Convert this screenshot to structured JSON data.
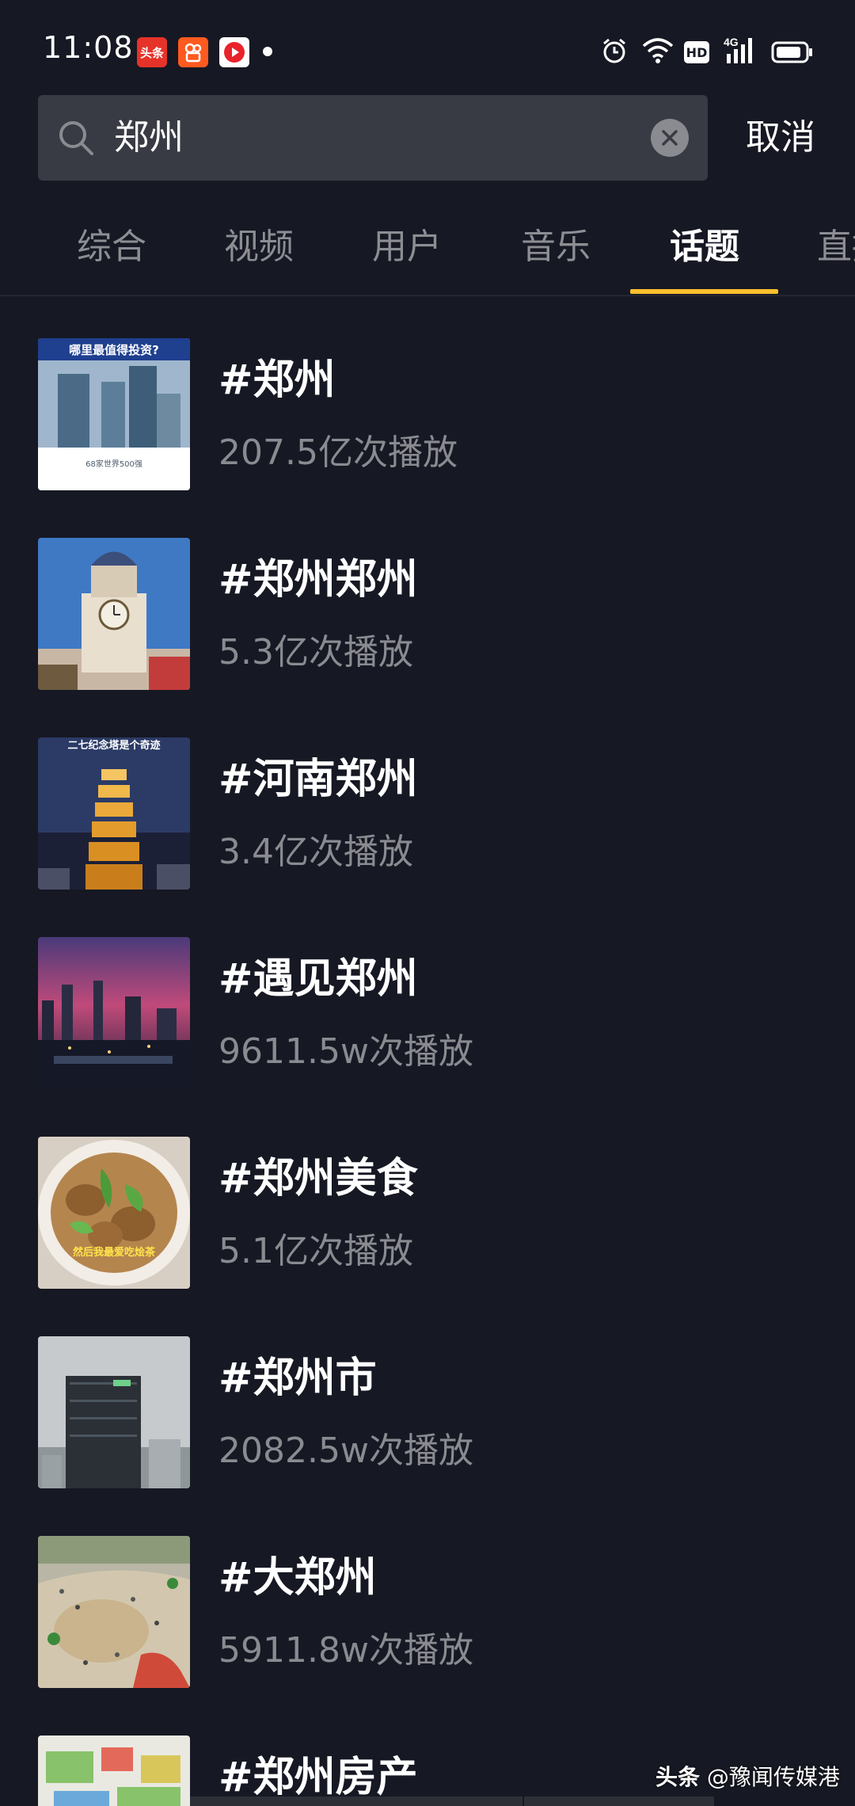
{
  "status_bar": {
    "time": "11:08",
    "app_icons": [
      "toutiao-icon",
      "kuaishou-icon",
      "video-app-icon"
    ],
    "toutiao_label": "头条",
    "hd_label": "HD",
    "network_label": "4G"
  },
  "search": {
    "query": "郑州",
    "cancel_label": "取消"
  },
  "tabs": [
    {
      "label": "综合",
      "active": false
    },
    {
      "label": "视频",
      "active": false
    },
    {
      "label": "用户",
      "active": false
    },
    {
      "label": "音乐",
      "active": false
    },
    {
      "label": "话题",
      "active": true
    },
    {
      "label": "直播",
      "active": false
    }
  ],
  "topics": [
    {
      "title": "#郑州",
      "count": "207.5亿次播放",
      "thumb_caption_top": "哪里最值得投资?",
      "thumb_caption_bottom": "68家世界500强"
    },
    {
      "title": "#郑州郑州",
      "count": "5.3亿次播放"
    },
    {
      "title": "#河南郑州",
      "count": "3.4亿次播放",
      "thumb_caption_top": "二七纪念塔是个奇迹"
    },
    {
      "title": "#遇见郑州",
      "count": "9611.5w次播放"
    },
    {
      "title": "#郑州美食",
      "count": "5.1亿次播放",
      "thumb_caption_bottom": "然后我最爱吃烩茶"
    },
    {
      "title": "#郑州市",
      "count": "2082.5w次播放"
    },
    {
      "title": "#大郑州",
      "count": "5911.8w次播放"
    },
    {
      "title": "#郑州房产",
      "count": ""
    }
  ],
  "watermark": {
    "brand": "头条",
    "handle": "@豫闻传媒港"
  },
  "colors": {
    "background": "#161823",
    "search_bg": "#393b44",
    "accent_indicator": "#fbc02d",
    "muted_text": "#8a8b91"
  }
}
